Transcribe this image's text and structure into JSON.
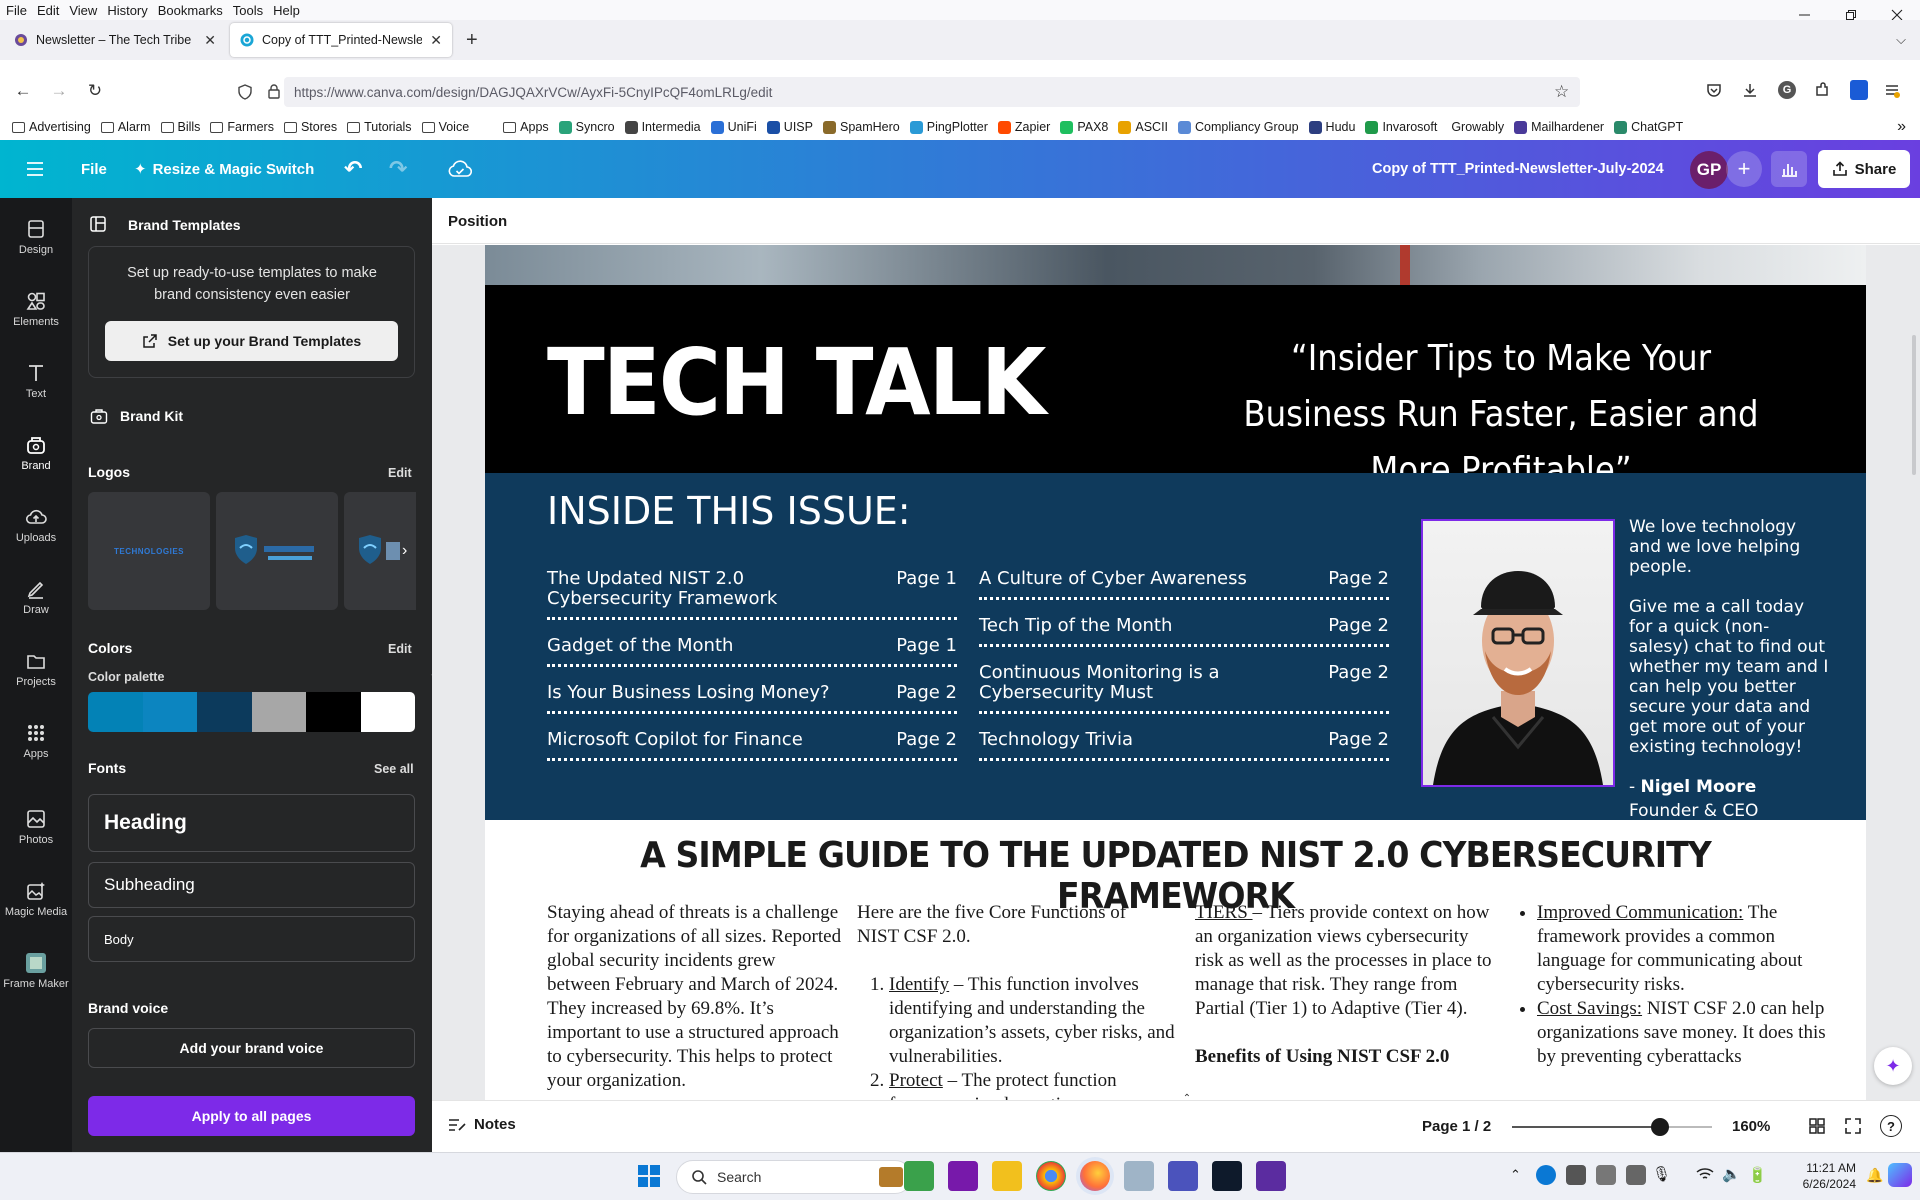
{
  "menubar": [
    "File",
    "Edit",
    "View",
    "History",
    "Bookmarks",
    "Tools",
    "Help"
  ],
  "tabs": [
    {
      "title": "Newsletter – The Tech Tribe",
      "active": false
    },
    {
      "title": "Copy of TTT_Printed-Newsletter",
      "active": true
    }
  ],
  "url": "https://www.canva.com/design/DAGJQAXrVCw/AyxFi-5CnyIPcQF4omLRLg/edit",
  "bookmarks": [
    "Advertising",
    "Alarm",
    "Bills",
    "Farmers",
    "Stores",
    "Tutorials",
    "Voice",
    "Apps",
    "Syncro",
    "Intermedia",
    "UniFi",
    "UISP",
    "SpamHero",
    "PingPlotter",
    "Zapier",
    "PAX8",
    "ASCII",
    "Compliancy Group",
    "Hudu",
    "Invarosoft",
    "Growably",
    "Mailhardener",
    "ChatGPT"
  ],
  "header": {
    "file": "File",
    "resize": "Resize & Magic Switch",
    "doc_title": "Copy of  TTT_Printed-Newsletter-July-2024",
    "avatar": "GP",
    "share": "Share"
  },
  "rail": [
    "Design",
    "Elements",
    "Text",
    "Brand",
    "Uploads",
    "Draw",
    "Projects",
    "Apps",
    "Photos",
    "Magic Media",
    "Frame Maker"
  ],
  "panel": {
    "title": "Brand Templates",
    "promo_text": "Set up ready-to-use templates to make brand consistency even easier",
    "promo_button": "Set up your Brand Templates",
    "brand_kit": "Brand Kit",
    "logos": "Logos",
    "logos_edit": "Edit",
    "logo_word": "TECHNOLOGIES",
    "colors": "Colors",
    "colors_edit": "Edit",
    "palette_label": "Color palette",
    "palette": [
      "#0382b6",
      "#0c85c0",
      "#0c3a5c",
      "#a7a7a7",
      "#000000",
      "#ffffff"
    ],
    "fonts": "Fonts",
    "fonts_see_all": "See all",
    "font_heading": "Heading",
    "font_subheading": "Subheading",
    "font_body": "Body",
    "brand_voice": "Brand voice",
    "add_voice": "Add your brand voice",
    "apply": "Apply to all pages"
  },
  "toolbar": {
    "position": "Position"
  },
  "newsletter": {
    "masthead": "TECH TALK",
    "tagline": "“Insider Tips to Make Your Business Run Faster, Easier and More Profitable”",
    "inside": "INSIDE THIS ISSUE:",
    "toc_left": [
      {
        "title": "The Updated NIST 2.0 Cybersecurity Framework",
        "page": "Page 1"
      },
      {
        "title": "Gadget of the Month",
        "page": "Page 1"
      },
      {
        "title": "Is Your Business Losing Money?",
        "page": "Page 2"
      },
      {
        "title": "Microsoft Copilot for Finance",
        "page": "Page 2"
      }
    ],
    "toc_right": [
      {
        "title": "A Culture of Cyber Awareness",
        "page": "Page 2"
      },
      {
        "title": "Tech Tip of the Month",
        "page": "Page 2"
      },
      {
        "title": "Continuous Monitoring is a Cybersecurity Must",
        "page": "Page 2"
      },
      {
        "title": "Technology Trivia",
        "page": "Page 2"
      }
    ],
    "bio_1": "We love technology and we love helping people.",
    "bio_2": "Give me a call today for a quick (non-salesy) chat to find out whether my team and I can help you better secure your data and get more out of your existing technology!",
    "bio_dash": "- ",
    "bio_name": "Nigel Moore",
    "bio_role": "Founder & CEO",
    "article_title": "A SIMPLE GUIDE TO THE UPDATED NIST 2.0 CYBERSECURITY FRAMEWORK",
    "col1": "Staying ahead of threats is a challenge for organizations of all sizes. Reported global security incidents grew between February and March of 2024. They increased by 69.8%. It’s important to use a structured approach to cybersecurity. This helps to protect your organization.",
    "col2_intro": "Here are the five Core Functions of NIST CSF 2.0.",
    "col2_items": [
      {
        "term": "Identify",
        "text": " – This function involves identifying and understanding the organization’s assets, cyber risks, and vulnerabilities."
      },
      {
        "term": "Protect",
        "text": " – The protect function focuses on implementing"
      }
    ],
    "col3_term": "TIERS ",
    "col3_text": "– Tiers provide context on how an organization views cybersecurity risk as well as the processes in place to manage that risk. They range from Partial (Tier 1) to Adaptive (Tier 4).",
    "col3_heading": "Benefits of Using NIST CSF 2.0",
    "col4_items": [
      {
        "term": "Improved Communication:",
        "text": " The framework provides a common language for communicating about cybersecurity risks."
      },
      {
        "term": "Cost Savings:",
        "text": " NIST CSF 2.0 can help organizations save money. It does this by preventing cyberattacks"
      }
    ]
  },
  "bottom": {
    "notes": "Notes",
    "page": "Page 1 / 2",
    "zoom": "160%",
    "zoom_level": 0.74
  },
  "taskbar": {
    "search": "Search",
    "time": "11:21 AM",
    "date": "6/26/2024"
  }
}
